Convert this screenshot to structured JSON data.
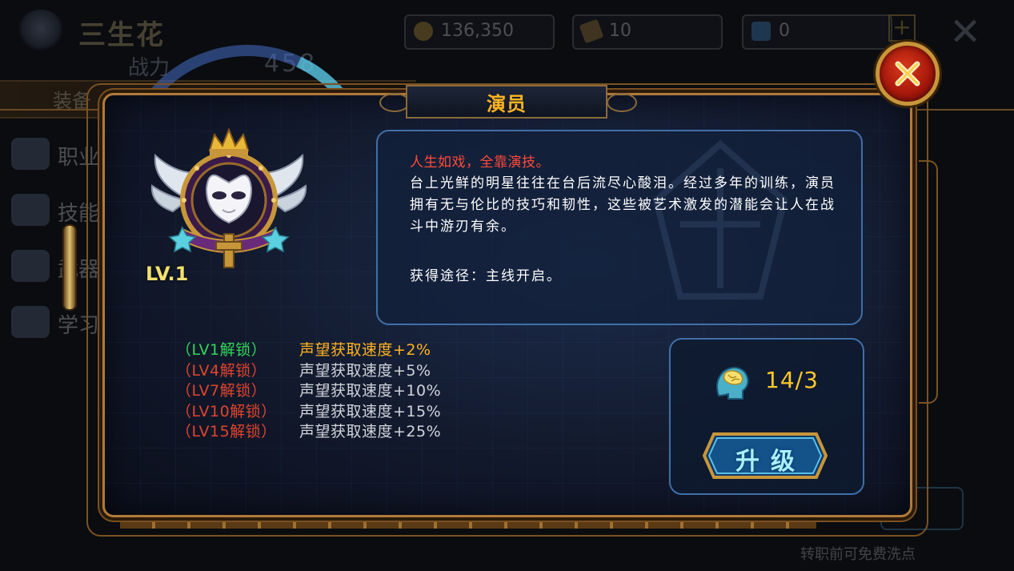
{
  "background": {
    "character_name": "三生花",
    "power_label": "战力",
    "power_value": "458",
    "resources": [
      {
        "icon": "coin-icon",
        "value": "136,350"
      },
      {
        "icon": "horn-icon",
        "value": "10"
      },
      {
        "icon": "gem-icon",
        "value": "0"
      }
    ],
    "tab_label": "装备",
    "side_items": [
      {
        "icon": "profession-icon",
        "label": "职业"
      },
      {
        "icon": "skill-book-icon",
        "label": "技能"
      },
      {
        "icon": "weapon-icon",
        "label": "武器"
      },
      {
        "icon": "study-icon",
        "label": "学习"
      }
    ],
    "hint": "转职前可免费洗点"
  },
  "dialog": {
    "title": "演员",
    "level": "LV.1",
    "headline": "人生如戏，全靠演技。",
    "description": "台上光鲜的明星往往在台后流尽心酸泪。经过多年的训练，演员拥有无与伦比的技巧和韧性，这些被艺术激发的潜能会让人在战斗中游刃有余。",
    "source": "获得途径：主线开启。",
    "unlocks": [
      {
        "level": "（LV1解锁）",
        "effect": "声望获取速度+2%",
        "unlocked": true
      },
      {
        "level": "（LV4解锁）",
        "effect": "声望获取速度+5%",
        "unlocked": false
      },
      {
        "level": "（LV7解锁）",
        "effect": "声望获取速度+10%",
        "unlocked": false
      },
      {
        "level": "（LV10解锁）",
        "effect": "声望获取速度+15%",
        "unlocked": false
      },
      {
        "level": "（LV15解锁）",
        "effect": "声望获取速度+25%",
        "unlocked": false
      }
    ],
    "points": "14/3",
    "upgrade_label": "升级"
  },
  "colors": {
    "title": "#ffb420",
    "headline": "#ff4a3a",
    "unlocked_level": "#33d65a",
    "locked_level": "#e0442e",
    "active_effect": "#ffb420",
    "frame_gold": "#b07a3a",
    "panel_border": "#3f6fa8"
  }
}
